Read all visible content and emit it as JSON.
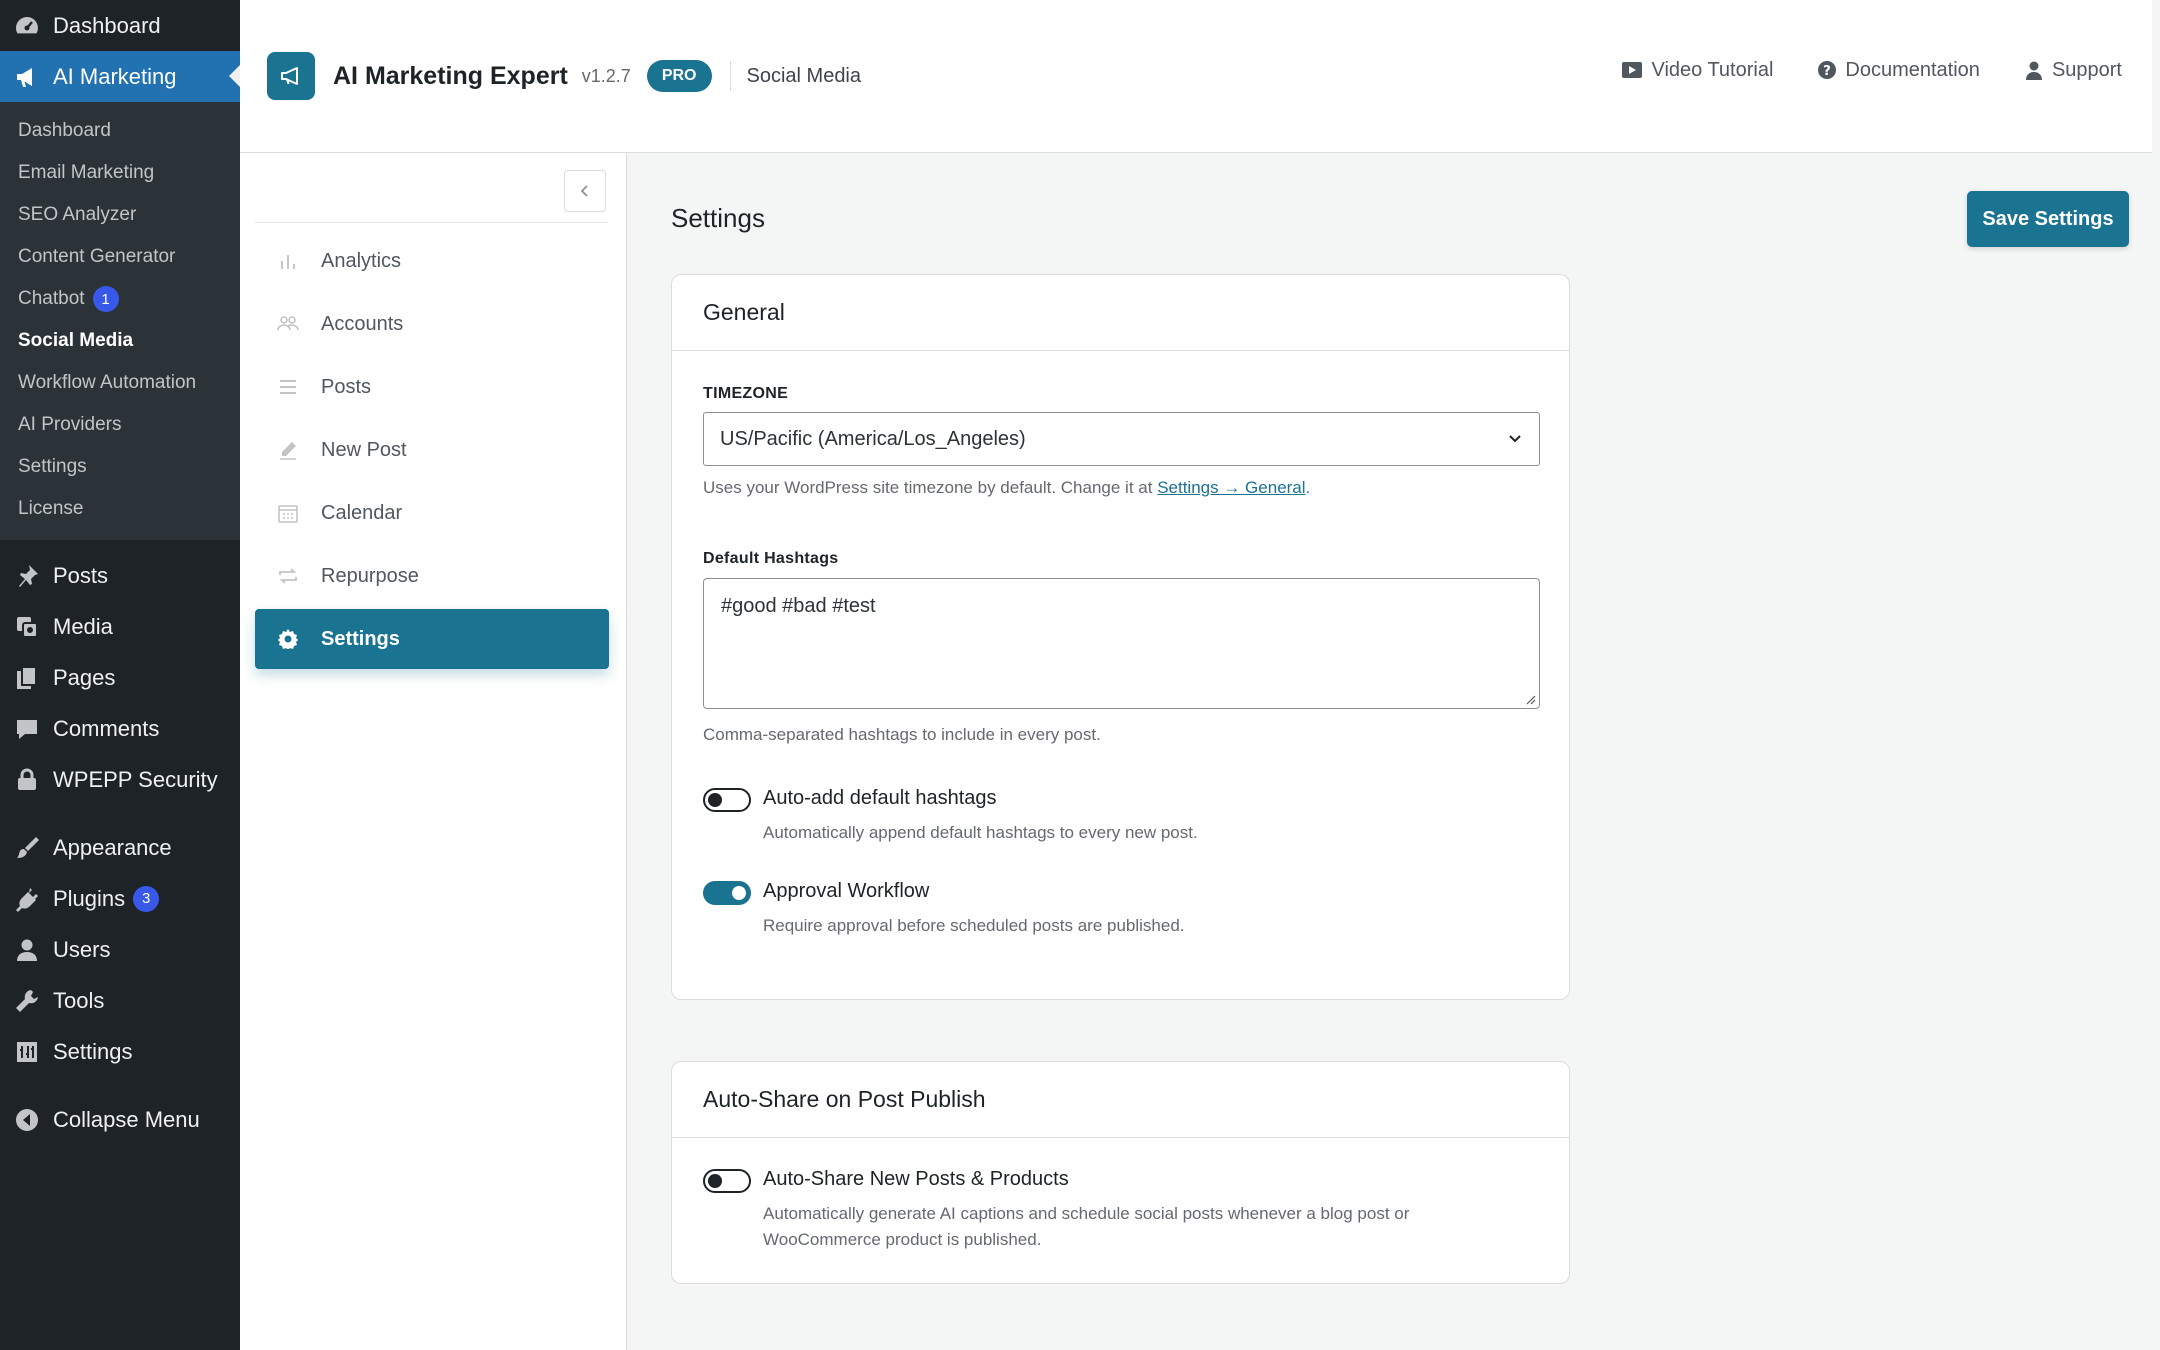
{
  "wp_sidebar": {
    "top_items": [
      {
        "label": "Dashboard",
        "icon": "dashboard-icon"
      },
      {
        "label": "AI Marketing",
        "icon": "megaphone-icon"
      }
    ],
    "submenu": [
      {
        "label": "Dashboard"
      },
      {
        "label": "Email Marketing"
      },
      {
        "label": "SEO Analyzer"
      },
      {
        "label": "Content Generator"
      },
      {
        "label": "Chatbot",
        "badge": "1"
      },
      {
        "label": "Social Media"
      },
      {
        "label": "Workflow Automation"
      },
      {
        "label": "AI Providers"
      },
      {
        "label": "Settings"
      },
      {
        "label": "License"
      }
    ],
    "menu": [
      {
        "label": "Posts",
        "icon": "pushpin-icon"
      },
      {
        "label": "Media",
        "icon": "media-icon"
      },
      {
        "label": "Pages",
        "icon": "pages-icon"
      },
      {
        "label": "Comments",
        "icon": "comment-icon"
      },
      {
        "label": "WPEPP Security",
        "icon": "lock-icon"
      },
      {
        "label": "Appearance",
        "icon": "paintbrush-icon"
      },
      {
        "label": "Plugins",
        "icon": "plugin-icon",
        "badge": "3"
      },
      {
        "label": "Users",
        "icon": "users-icon"
      },
      {
        "label": "Tools",
        "icon": "wrench-icon"
      },
      {
        "label": "Settings",
        "icon": "settings-icon"
      },
      {
        "label": "Collapse Menu",
        "icon": "collapse-icon"
      }
    ]
  },
  "header": {
    "brand_name": "AI Marketing Expert",
    "version": "v1.2.7",
    "badge": "PRO",
    "section": "Social Media",
    "links": [
      {
        "label": "Video Tutorial",
        "icon": "video-icon"
      },
      {
        "label": "Documentation",
        "icon": "help-icon"
      },
      {
        "label": "Support",
        "icon": "user-icon"
      }
    ]
  },
  "plugin_nav": {
    "items": [
      {
        "label": "Analytics",
        "icon": "bar-chart-icon"
      },
      {
        "label": "Accounts",
        "icon": "users-icon"
      },
      {
        "label": "Posts",
        "icon": "list-icon"
      },
      {
        "label": "New Post",
        "icon": "pencil-icon"
      },
      {
        "label": "Calendar",
        "icon": "calendar-icon"
      },
      {
        "label": "Repurpose",
        "icon": "repeat-icon"
      },
      {
        "label": "Settings",
        "icon": "gear-icon",
        "active": true
      }
    ]
  },
  "page": {
    "title": "Settings",
    "save_label": "Save Settings"
  },
  "general": {
    "title": "General",
    "timezone_label": "TIMEZONE",
    "timezone_value": "US/Pacific (America/Los_Angeles)",
    "timezone_help_prefix": "Uses your WordPress site timezone by default. Change it at ",
    "timezone_help_link": "Settings → General",
    "timezone_help_suffix": ".",
    "hashtags_label": "Default Hashtags",
    "hashtags_value": "#good #bad #test",
    "hashtags_help": "Comma-separated hashtags to include in every post.",
    "auto_add": {
      "title": "Auto-add default hashtags",
      "desc": "Automatically append default hashtags to every new post.",
      "enabled": false
    },
    "approval": {
      "title": "Approval Workflow",
      "desc": "Require approval before scheduled posts are published.",
      "enabled": true
    }
  },
  "auto_share": {
    "title": "Auto-Share on Post Publish",
    "toggle_title": "Auto-Share New Posts & Products",
    "toggle_desc": "Automatically generate AI captions and schedule social posts whenever a blog post or WooCommerce product is published.",
    "enabled": false
  },
  "colors": {
    "accent": "#1a7391",
    "wp_sidebar_bg": "#1d2327",
    "wp_active": "#2271b1",
    "badge": "#3858e9"
  }
}
